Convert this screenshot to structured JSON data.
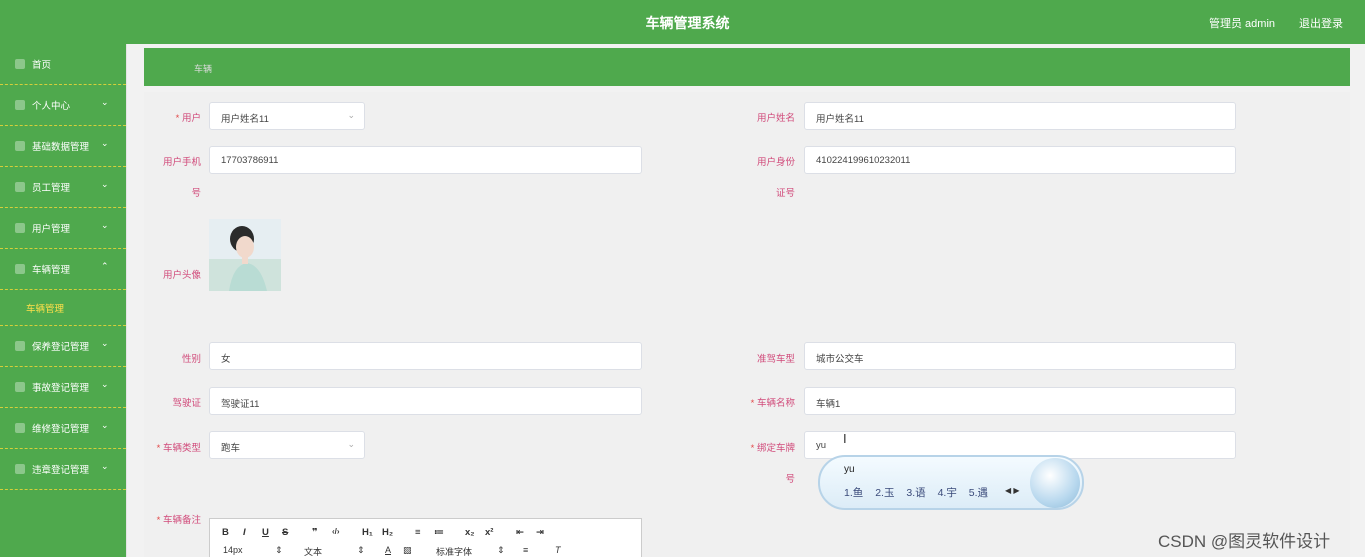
{
  "header": {
    "title": "车辆管理系统",
    "admin_label": "管理员 admin",
    "logout": "退出登录"
  },
  "sidebar": {
    "items": [
      {
        "label": "首页",
        "icon": "home-icon"
      },
      {
        "label": "个人中心",
        "icon": "user-icon"
      },
      {
        "label": "基础数据管理",
        "icon": "gear-icon"
      },
      {
        "label": "员工管理",
        "icon": "staff-icon"
      },
      {
        "label": "用户管理",
        "icon": "users-icon"
      },
      {
        "label": "车辆管理",
        "icon": "car-icon",
        "expanded": true
      },
      {
        "label": "保养登记管理",
        "icon": "wrench-icon"
      },
      {
        "label": "事故登记管理",
        "icon": "alert-icon"
      },
      {
        "label": "维修登记管理",
        "icon": "tool-icon"
      },
      {
        "label": "违章登记管理",
        "icon": "ticket-icon"
      }
    ],
    "sub_item": "车辆管理"
  },
  "breadcrumb": "车辆",
  "form": {
    "user": {
      "label": "用户",
      "value": "用户姓名11"
    },
    "user_name": {
      "label": "用户姓名",
      "value": "用户姓名11"
    },
    "user_phone": {
      "label_line1": "用户手机",
      "label_line2": "号",
      "value": "17703786911"
    },
    "user_id": {
      "label_line1": "用户身份",
      "label_line2": "证号",
      "value": "410224199610232011"
    },
    "avatar_label": "用户头像",
    "gender": {
      "label": "性别",
      "value": "女"
    },
    "vehicle_class": {
      "label": "准驾车型",
      "value": "城市公交车"
    },
    "license": {
      "label": "驾驶证",
      "value": "驾驶证11"
    },
    "vehicle_name": {
      "label": "车辆名称",
      "value": "车辆1"
    },
    "vehicle_type": {
      "label": "车辆类型",
      "value": "跑车"
    },
    "plate": {
      "label_line1": "绑定车牌",
      "label_line2": "号",
      "value": "yu"
    },
    "remark_label": "车辆备注",
    "required_mark": "*"
  },
  "editor_toolbar": {
    "row1": [
      "B",
      "I",
      "U",
      "S",
      "❞",
      "‹/›",
      "H₁",
      "H₂",
      "≡",
      "≔",
      "x₂",
      "x²",
      "⇤",
      "⇥"
    ],
    "font_size": "14px",
    "text_style": "文本",
    "font_family": "标准字体"
  },
  "ime": {
    "code": "yu",
    "candidates": [
      "1.鱼",
      "2.玉",
      "3.语",
      "4.宇",
      "5.遇"
    ],
    "nav": "◀ ▶"
  },
  "watermark": "CSDN @图灵软件设计"
}
